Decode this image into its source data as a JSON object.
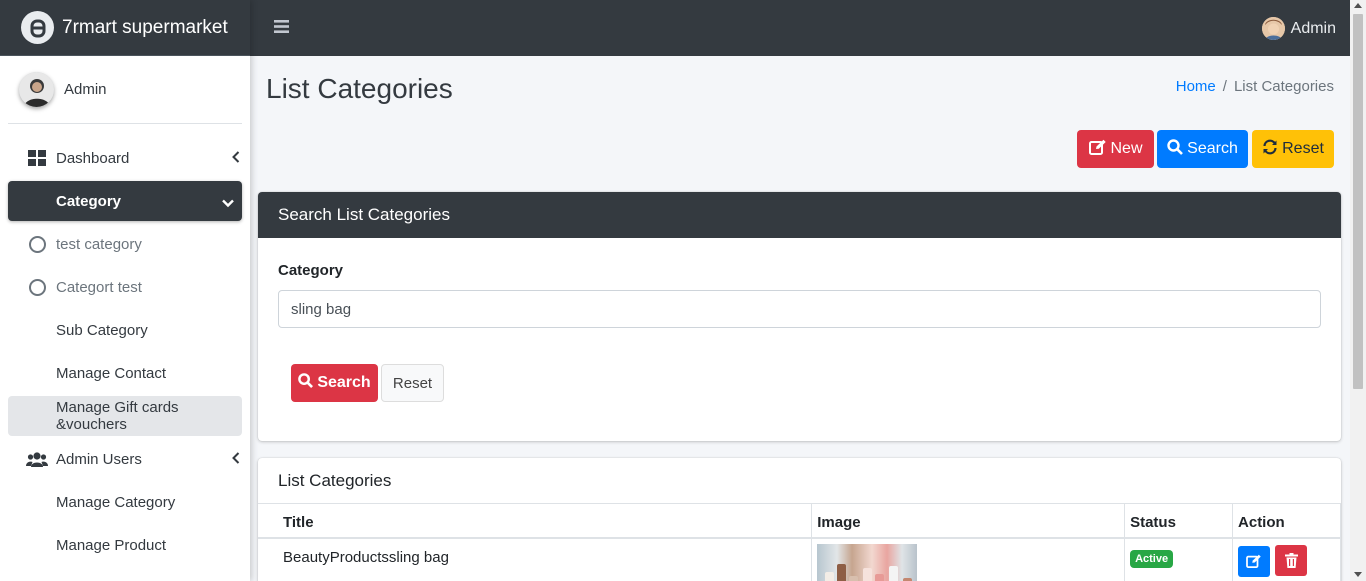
{
  "brand": {
    "name": "7rmart supermarket"
  },
  "sidebar": {
    "user_name": "Admin",
    "items": [
      {
        "label": "Dashboard"
      },
      {
        "label": "Category"
      },
      {
        "label": "test category"
      },
      {
        "label": "Categort test"
      },
      {
        "label": "Sub Category"
      },
      {
        "label": "Manage Contact"
      },
      {
        "label": "Manage Gift cards &vouchers"
      },
      {
        "label": "Admin Users"
      },
      {
        "label": "Manage Category"
      },
      {
        "label": "Manage Product"
      }
    ]
  },
  "topbar": {
    "user_name": "Admin"
  },
  "page": {
    "title": "List Categories",
    "breadcrumb": {
      "home": "Home",
      "sep": "/",
      "current": "List Categories"
    }
  },
  "toolbar": {
    "new_label": "New",
    "search_label": "Search",
    "reset_label": "Reset"
  },
  "search_card": {
    "header": "Search List Categories",
    "field_label": "Category",
    "field_value": "sling bag",
    "search_button": "Search",
    "reset_button": "Reset"
  },
  "list_card": {
    "header": "List Categories",
    "columns": [
      "Title",
      "Image",
      "Status",
      "Action"
    ],
    "rows": [
      {
        "title": "BeautyProductssling bag",
        "status": "Active"
      }
    ]
  },
  "colors": {
    "dark": "#343a40",
    "primary": "#007bff",
    "danger": "#dc3545",
    "warning": "#ffc107",
    "success": "#28a745"
  }
}
